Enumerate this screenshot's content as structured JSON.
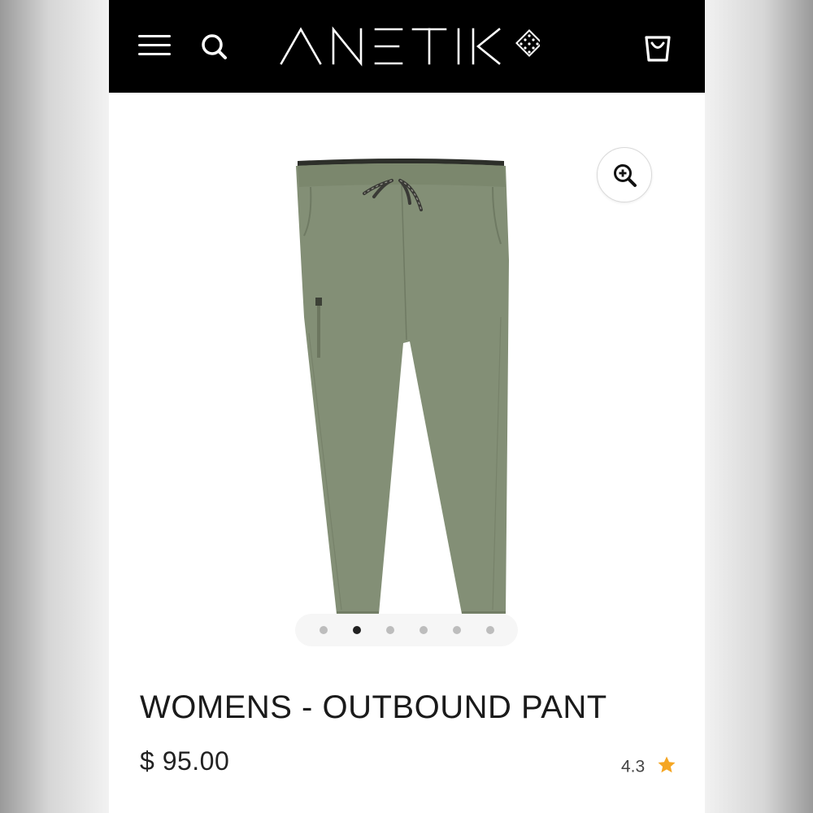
{
  "header": {
    "brand": "ANETIK",
    "background_color": "#000000",
    "menu_icon": "hamburger-menu-icon",
    "search_icon": "search-icon",
    "cart_icon": "shopping-bag-icon"
  },
  "product": {
    "image_alt": "olive green womens pants",
    "image_color": "#838f76",
    "zoom_icon": "zoom-in-icon",
    "gallery": {
      "total": 6,
      "active_index": 1
    },
    "title": "WOMENS - OUTBOUND PANT",
    "price": "$ 95.00",
    "rating": "4.3",
    "rating_icon": "star-icon",
    "star_color": "#f5a623"
  }
}
